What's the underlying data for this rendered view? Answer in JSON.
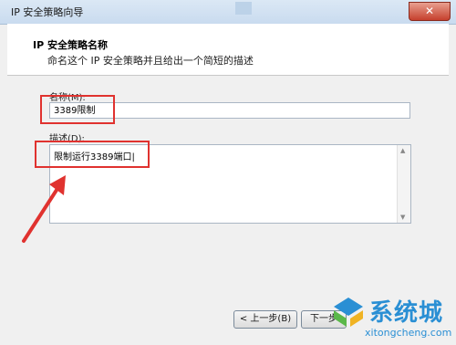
{
  "window": {
    "title": "IP 安全策略向导",
    "close_label": "✕"
  },
  "header": {
    "title": "IP 安全策略名称",
    "description": "命名这个 IP 安全策略并且给出一个简短的描述"
  },
  "form": {
    "name_label": "名称(M):",
    "name_value": "3389限制",
    "desc_label": "描述(D):",
    "desc_value": "限制运行3389端口|"
  },
  "buttons": {
    "back": "< 上一步(B)",
    "next": "下一步"
  },
  "watermark": {
    "brand": "系统城",
    "url": "xitongcheng.com"
  },
  "colors": {
    "highlight": "#e0322f",
    "watermark": "#2a8fd4"
  }
}
